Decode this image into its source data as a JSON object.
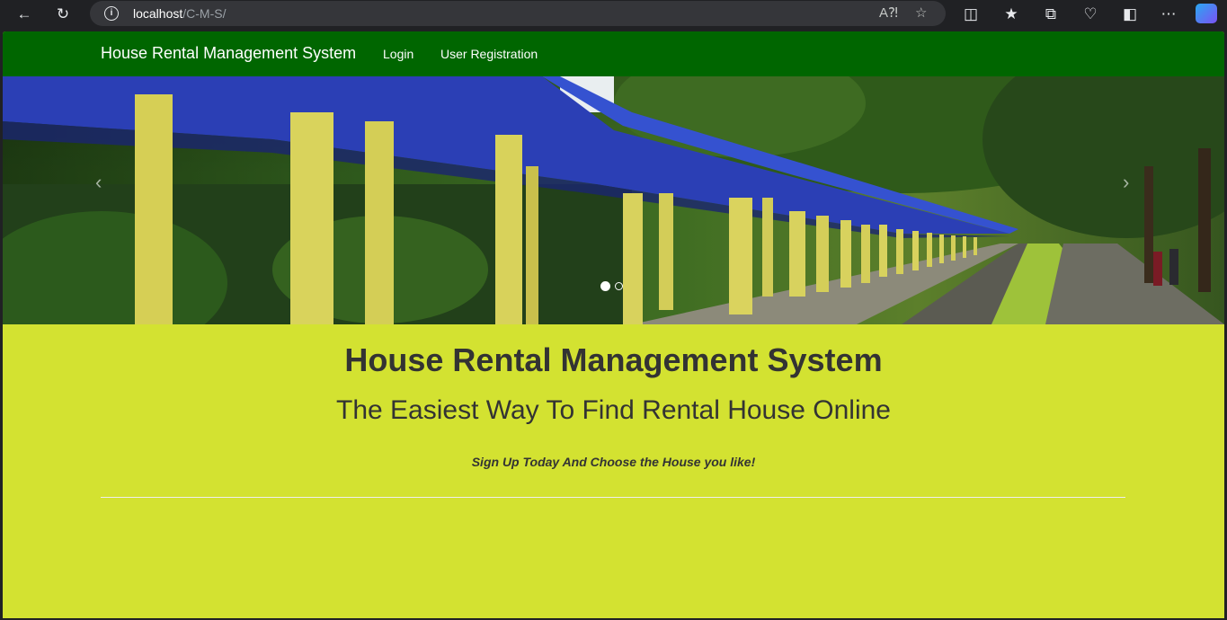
{
  "browser": {
    "url_host": "localhost",
    "url_path": "/C-M-S/"
  },
  "navbar": {
    "brand": "House Rental Management System",
    "links": [
      "Login",
      "User Registration"
    ]
  },
  "carousel": {
    "prev_symbol": "‹",
    "next_symbol": "›",
    "slide_count": 2,
    "active_slide": 1
  },
  "hero": {
    "title": "House Rental Management System",
    "subtitle": "The Easiest Way To Find Rental House Online",
    "note": "Sign Up Today And Choose the House you like!"
  },
  "colors": {
    "navbar": "#006600",
    "page_background": "#d3e231",
    "text": "#333333"
  }
}
